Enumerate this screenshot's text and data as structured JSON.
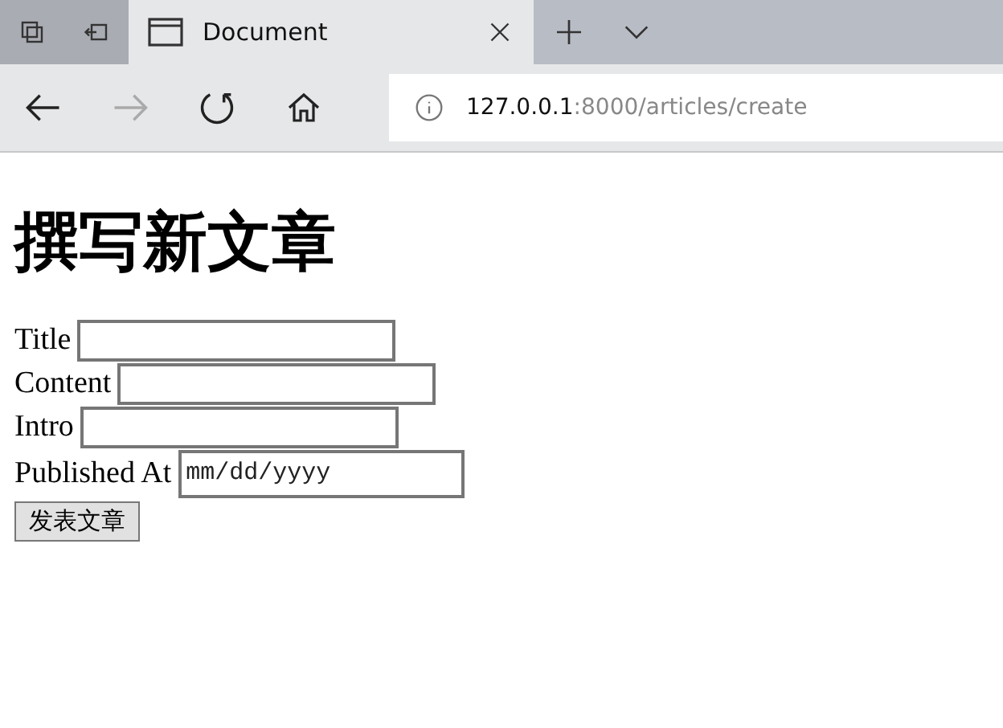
{
  "browser": {
    "tab": {
      "title": "Document",
      "selected": true
    },
    "address": {
      "host": "127.0.0.1",
      "path": ":8000/articles/create"
    },
    "forward_disabled": true
  },
  "page": {
    "heading": "撰写新文章",
    "fields": [
      {
        "label": "Title",
        "kind": "text"
      },
      {
        "label": "Content",
        "kind": "text"
      },
      {
        "label": "Intro",
        "kind": "text"
      },
      {
        "label": "Published At",
        "kind": "date",
        "placeholder": "mm/dd/yyyy"
      }
    ],
    "submit": "发表文章"
  }
}
